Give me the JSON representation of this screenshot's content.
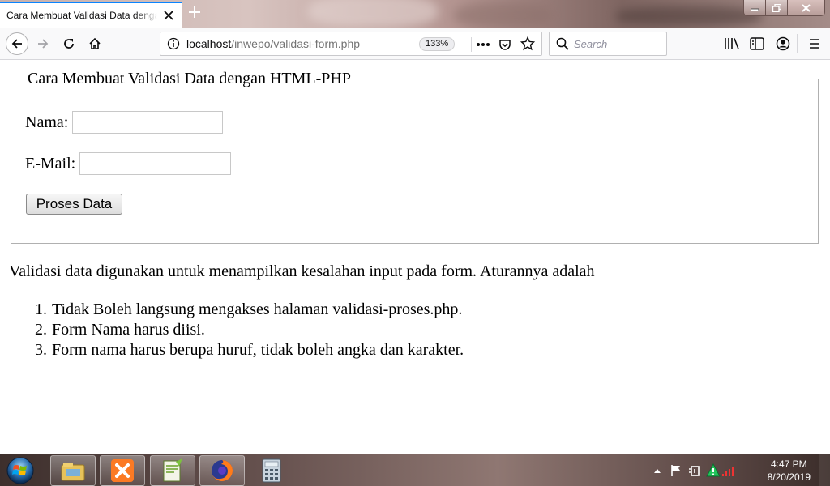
{
  "browser": {
    "tab_title": "Cara Membuat Validasi Data dengan HTML-PHP",
    "url_host": "localhost",
    "url_path": "/inwepo/validasi-form.php",
    "zoom": "133%",
    "search_placeholder": "Search"
  },
  "page": {
    "legend": "Cara Membuat Validasi Data dengan HTML-PHP",
    "name_label": "Nama:",
    "name_value": "",
    "email_label": "E-Mail:",
    "email_value": "",
    "submit_label": "Proses Data",
    "intro": "Validasi data digunakan untuk menampilkan kesalahan input pada form. Aturannya adalah",
    "rules": [
      {
        "num": "1.",
        "text": "Tidak Boleh langsung mengakses halaman validasi-proses.php."
      },
      {
        "num": "2.",
        "text": "Form Nama harus diisi."
      },
      {
        "num": "3.",
        "text": "Form nama harus berupa huruf, tidak boleh angka dan karakter."
      }
    ]
  },
  "taskbar": {
    "time": "4:47 PM",
    "date": "8/20/2019",
    "apps": [
      "start-orb",
      "file-explorer-icon",
      "xampp-icon",
      "notepad-plus-plus-icon",
      "firefox-icon",
      "calculator-icon"
    ]
  },
  "colors": {
    "accent": "#0a84ff",
    "tab_bg": "#ffffff",
    "toolbar_bg": "#f9f9fa"
  }
}
